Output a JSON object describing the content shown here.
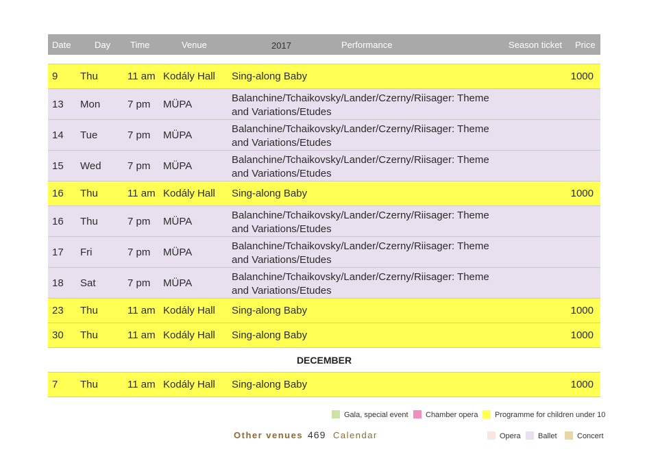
{
  "header": {
    "date": "Date",
    "day": "Day",
    "time": "Time",
    "venue": "Venue",
    "year": "2017",
    "performance": "Performance",
    "season_ticket": "Season ticket",
    "price": "Price"
  },
  "rows": [
    {
      "type": "yellow",
      "date": "9",
      "day": "Thu",
      "time": "11 am",
      "venue": "Kodály Hall",
      "performance": "Sing-along Baby",
      "price": "1000"
    },
    {
      "type": "purple",
      "date": "13",
      "day": "Mon",
      "time": "7 pm",
      "venue": "MÜPA",
      "performance": "Balanchine/Tchaikovsky/Lander/Czerny/Riisager: Theme and Variations/Etudes",
      "price": ""
    },
    {
      "type": "purple",
      "date": "14",
      "day": "Tue",
      "time": "7 pm",
      "venue": "MÜPA",
      "performance": "Balanchine/Tchaikovsky/Lander/Czerny/Riisager: Theme and Variations/Etudes",
      "price": ""
    },
    {
      "type": "purple",
      "date": "15",
      "day": "Wed",
      "time": "7 pm",
      "venue": "MÜPA",
      "performance": "Balanchine/Tchaikovsky/Lander/Czerny/Riisager: Theme and Variations/Etudes",
      "price": ""
    },
    {
      "type": "yellow",
      "date": "16",
      "day": "Thu",
      "time": "11 am",
      "venue": "Kodály Hall",
      "performance": "Sing-along Baby",
      "price": "1000"
    },
    {
      "type": "purple",
      "date": "16",
      "day": "Thu",
      "time": "7 pm",
      "venue": "MÜPA",
      "performance": "Balanchine/Tchaikovsky/Lander/Czerny/Riisager: Theme and Variations/Etudes",
      "price": ""
    },
    {
      "type": "purple",
      "date": "17",
      "day": "Fri",
      "time": "7 pm",
      "venue": "MÜPA",
      "performance": "Balanchine/Tchaikovsky/Lander/Czerny/Riisager: Theme and Variations/Etudes",
      "price": ""
    },
    {
      "type": "purple",
      "date": "18",
      "day": "Sat",
      "time": "7 pm",
      "venue": "MÜPA",
      "performance": "Balanchine/Tchaikovsky/Lander/Czerny/Riisager: Theme and Variations/Etudes",
      "price": ""
    },
    {
      "type": "yellow",
      "date": "23",
      "day": "Thu",
      "time": "11 am",
      "venue": "Kodály Hall",
      "performance": "Sing-along Baby",
      "price": "1000"
    },
    {
      "type": "yellow",
      "date": "30",
      "day": "Thu",
      "time": "11 am",
      "venue": "Kodály Hall",
      "performance": "Sing-along Baby",
      "price": "1000"
    },
    {
      "type": "month",
      "label": "DECEMBER"
    },
    {
      "type": "yellow",
      "date": "7",
      "day": "Thu",
      "time": "11 am",
      "venue": "Kodály Hall",
      "performance": "Sing-along Baby",
      "price": "1000"
    }
  ],
  "legend": {
    "gala": {
      "label": "Gala, special event",
      "color": "#cde3a6"
    },
    "chamber": {
      "label": "Chamber opera",
      "color": "#ee8fbf"
    },
    "children": {
      "label": "Programme for children under 10",
      "color": "#ffff54"
    },
    "opera": {
      "label": "Opera",
      "color": "#f8e6df"
    },
    "ballet": {
      "label": "Ballet",
      "color": "#e8e0ef"
    },
    "concert": {
      "label": "Concert",
      "color": "#e9d6a6"
    }
  },
  "footer": {
    "venues": "Other venues",
    "page": "469",
    "section": "Calendar"
  }
}
